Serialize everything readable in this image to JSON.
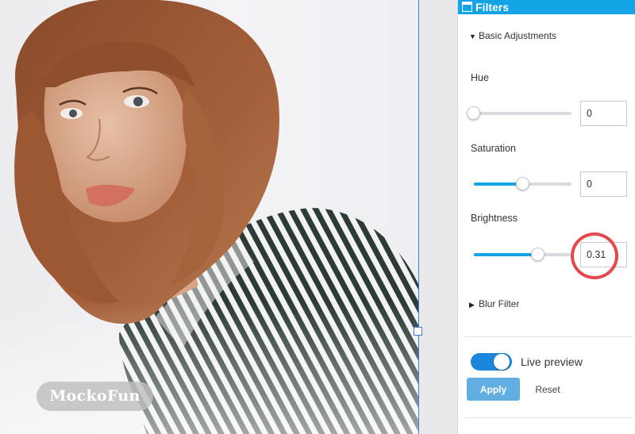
{
  "watermark": {
    "text": "MockoFun"
  },
  "panel": {
    "title": "Filters",
    "header_icon": "window-icon",
    "accent_color": "#13a4e6",
    "sections": {
      "basic_adjustments": {
        "label": "Basic Adjustments",
        "expanded": true,
        "caret": "▼"
      },
      "blur_filter": {
        "label": "Blur Filter",
        "expanded": false,
        "caret": "▶"
      }
    },
    "hue": {
      "label": "Hue",
      "value": "0",
      "slider_fraction": 0.0
    },
    "saturation": {
      "label": "Saturation",
      "value": "0",
      "slider_fraction": 0.5
    },
    "brightness": {
      "label": "Brightness",
      "value": "0.31",
      "slider_fraction": 0.655,
      "highlight_color": "#e5494e"
    },
    "live_preview": {
      "label": "Live preview",
      "on": true,
      "toggle_color": "#1c86dc"
    },
    "apply_label": "Apply",
    "reset_label": "Reset"
  }
}
